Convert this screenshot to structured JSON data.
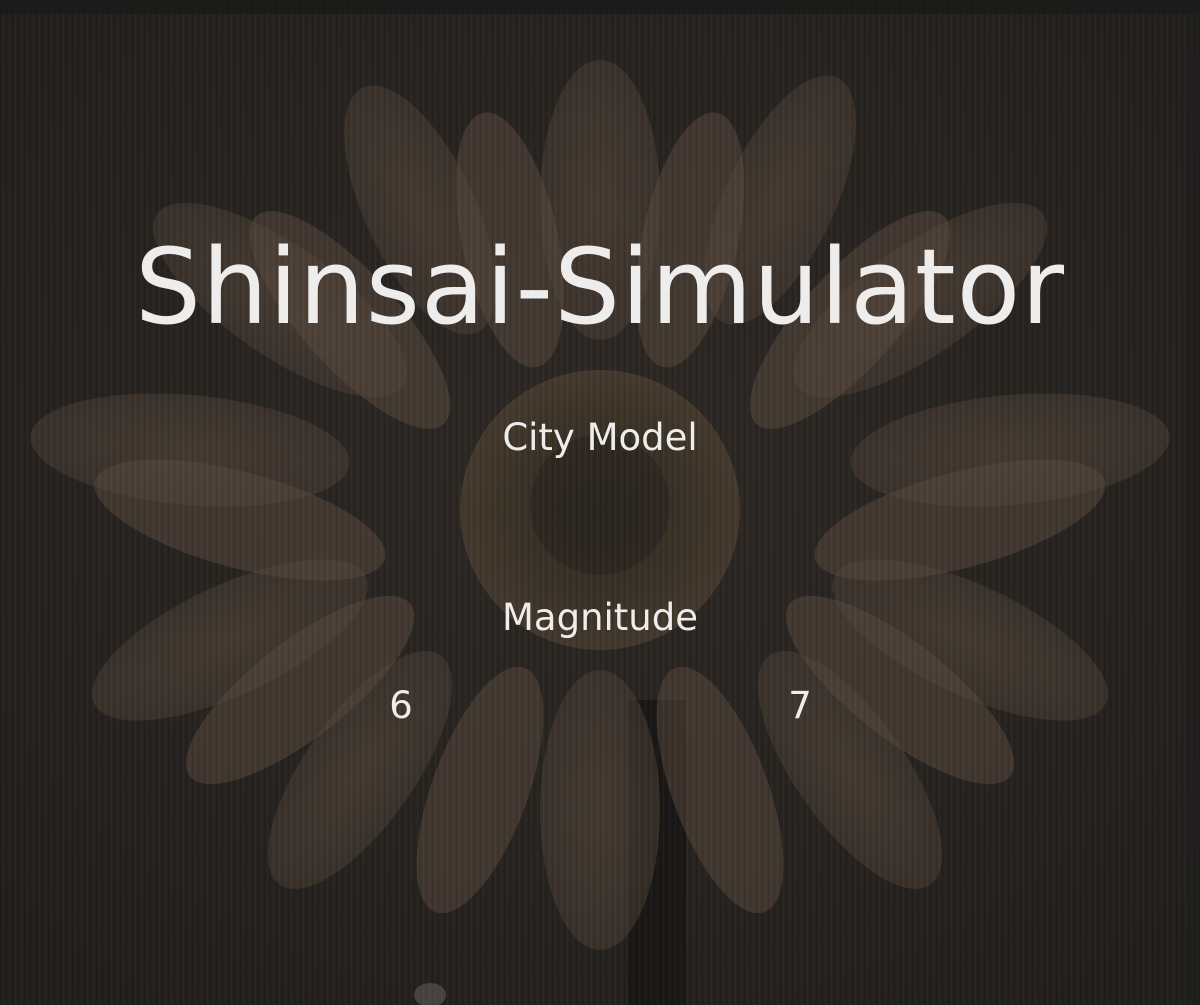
{
  "app": {
    "title": "Shinsai-Simulator"
  },
  "menu": {
    "city_model_label": "City Model",
    "magnitude_label": "Magnitude",
    "magnitude_options": [
      "6",
      "7"
    ]
  },
  "background": {
    "image": "gerbera-daisy-photo",
    "overlay_color": "#2b2724",
    "petal_color": "#9a7c64",
    "center_color": "#5d5235",
    "stem_color": "#151412"
  },
  "colors": {
    "text": "#efedec"
  }
}
